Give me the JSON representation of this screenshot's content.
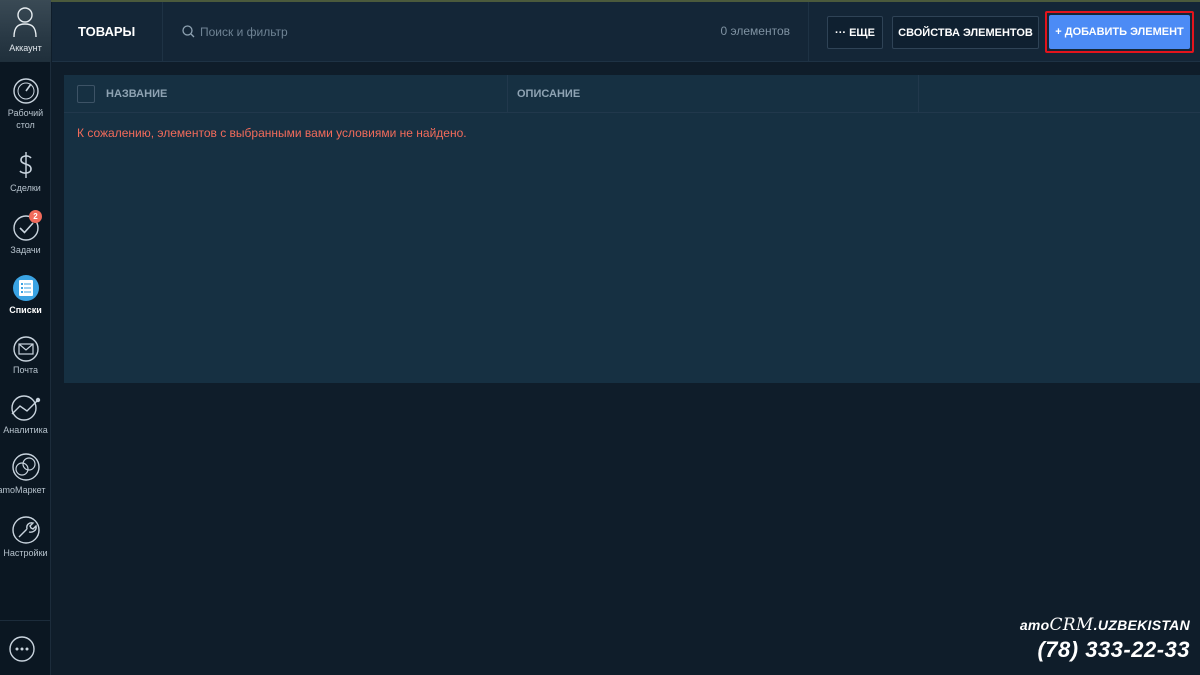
{
  "sidebar": {
    "account_label": "Аккаунт",
    "items": [
      {
        "id": "dashboard",
        "label_line1": "Рабочий",
        "label_line2": "стол",
        "icon": "dashboard-icon"
      },
      {
        "id": "deals",
        "label": "Сделки",
        "icon": "dollar-icon"
      },
      {
        "id": "tasks",
        "label": "Задачи",
        "icon": "check-icon",
        "badge": "2"
      },
      {
        "id": "lists",
        "label": "Списки",
        "icon": "list-icon",
        "active": true
      },
      {
        "id": "mail",
        "label": "Почта",
        "icon": "mail-icon"
      },
      {
        "id": "analytics",
        "label": "Аналитика",
        "icon": "analytics-icon"
      },
      {
        "id": "amomarket",
        "label": "amoМаркет",
        "icon": "market-icon"
      },
      {
        "id": "settings",
        "label": "Настройки",
        "icon": "wrench-icon"
      }
    ],
    "chat_icon": "chat-icon"
  },
  "header": {
    "title": "ТОВАРЫ",
    "search_placeholder": "Поиск и фильтр",
    "count": "0 элементов",
    "more_label": "··· ЕЩЕ",
    "properties_label": "СВОЙСТВА ЭЛЕМЕНТОВ",
    "add_label": "+ ДОБАВИТЬ ЭЛЕМЕНТ"
  },
  "table": {
    "columns": [
      "НАЗВАНИЕ",
      "ОПИСАНИЕ"
    ],
    "empty_message": "К сожалению, элементов с выбранными вами условиями не найдено."
  },
  "brand": {
    "name_amo": "amo",
    "name_crm": "CRM",
    "name_suffix": ".UZBEKISTAN",
    "phone": "(78) 333-22-33"
  },
  "colors": {
    "accent": "#4c8bf5",
    "highlight": "#e3141c",
    "error": "#f26b5b",
    "badge": "#f26b5b"
  }
}
